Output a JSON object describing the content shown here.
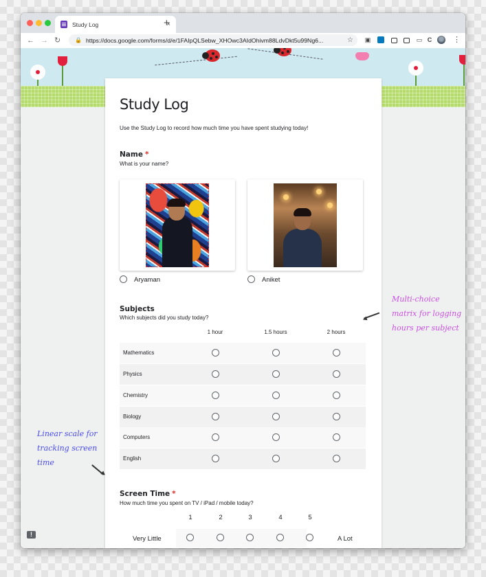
{
  "browser": {
    "tab_title": "Study Log",
    "tab_close": "×",
    "new_tab": "+",
    "url": "https://docs.google.com/forms/d/e/1FAIpQLSebw_XHOwc3AIdOhivm88LdvDkt5u99Ng6...",
    "nav": {
      "back": "←",
      "forward": "→",
      "reload": "↻"
    },
    "icons": {
      "lock": "🔒",
      "star": "☆",
      "menu": "⋮"
    }
  },
  "form": {
    "title": "Study Log",
    "description": "Use the Study Log to record how much time you have spent studying today!",
    "questions": {
      "name": {
        "title": "Name",
        "required_mark": "*",
        "help": "What is your name?",
        "options": [
          {
            "label": "Aryaman",
            "selected": false
          },
          {
            "label": "Aniket",
            "selected": false
          }
        ]
      },
      "subjects": {
        "title": "Subjects",
        "help": "Which subjects did you study today?",
        "columns": [
          "1 hour",
          "1.5 hours",
          "2 hours"
        ],
        "rows": [
          "Mathematics",
          "Physics",
          "Chemistry",
          "Biology",
          "Computers",
          "English"
        ]
      },
      "screen_time": {
        "title": "Screen Time",
        "required_mark": "*",
        "help": "How much time you spent on TV / iPad / mobile today?",
        "scale": [
          "1",
          "2",
          "3",
          "4",
          "5"
        ],
        "min_label": "Very Little",
        "max_label": "A Lot"
      }
    }
  },
  "annotations": {
    "right": [
      "Multi-choice",
      "matrix for logging",
      "hours per subject"
    ],
    "left": [
      "Linear scale for",
      "tracking screen",
      "time"
    ]
  },
  "feedback_icon": "!",
  "colors": {
    "form_accent": "#673ab7",
    "required": "#d93025",
    "annotation_right": "#c94fe0",
    "annotation_left": "#4a4aeb"
  }
}
